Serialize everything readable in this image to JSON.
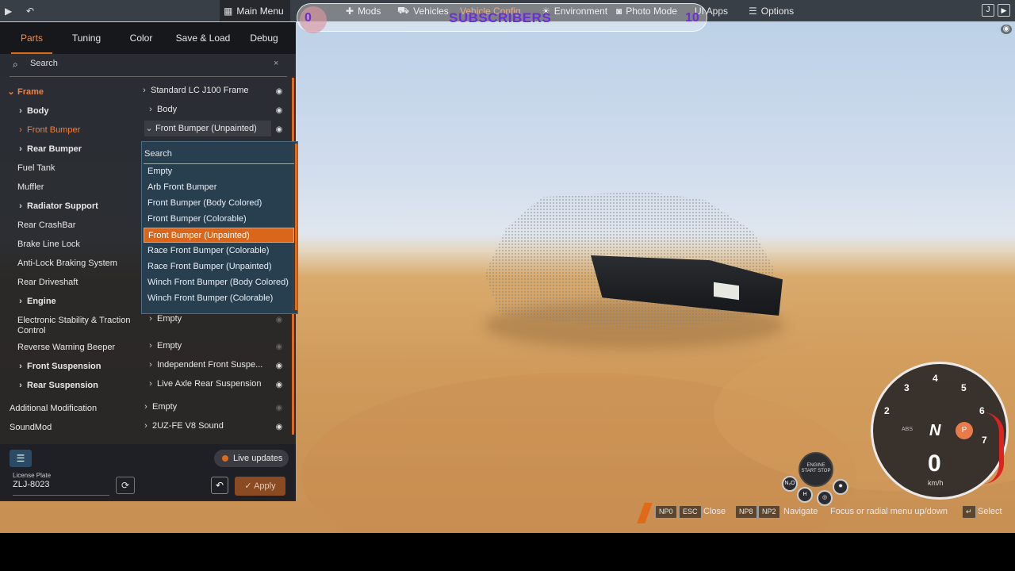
{
  "topbar": {
    "main_menu": "Main Menu",
    "mods": "Mods",
    "vehicles": "Vehicles",
    "vehicle_config": "Vehicle Config",
    "environment": "Environment",
    "photo_mode": "Photo Mode",
    "ui_apps": "UI Apps",
    "options": "Options"
  },
  "subscribers": {
    "title": "SUBSCRIBERS",
    "left_count": "0",
    "right_count": "10"
  },
  "tabs": [
    "Parts",
    "Tuning",
    "Color",
    "Save & Load",
    "Debug"
  ],
  "search": {
    "placeholder": "Search",
    "clear": "×"
  },
  "slots": [
    {
      "label": "Frame",
      "chev": "⌄",
      "part": "Standard LC J100 Frame",
      "part_chev": "›"
    },
    {
      "label": "Body",
      "chev": "›",
      "part": "Body",
      "part_chev": "›"
    },
    {
      "label": "Front Bumper",
      "chev": "›",
      "part": "Front Bumper (Unpainted)",
      "part_chev": "⌄"
    },
    {
      "label": "Rear Bumper",
      "chev": "›"
    },
    {
      "label": "Fuel Tank"
    },
    {
      "label": "Muffler"
    },
    {
      "label": "Radiator Support",
      "chev": "›"
    },
    {
      "label": "Rear CrashBar"
    },
    {
      "label": "Brake Line Lock"
    },
    {
      "label": "Anti-Lock Braking System"
    },
    {
      "label": "Rear Driveshaft"
    },
    {
      "label": "Engine",
      "chev": "›"
    },
    {
      "label": "Electronic Stability & Traction Control",
      "part": "Empty",
      "part_chev": "›"
    },
    {
      "label": "Reverse Warning Beeper",
      "part": "Empty",
      "part_chev": "›"
    },
    {
      "label": "Front Suspension",
      "chev": "›",
      "part": "Independent Front Suspe...",
      "part_chev": "›"
    },
    {
      "label": "Rear Suspension",
      "chev": "›",
      "part": "Live Axle Rear Suspension",
      "part_chev": "›"
    },
    {
      "label": "Additional Modification",
      "part": "Empty",
      "part_chev": "›"
    },
    {
      "label": "SoundMod",
      "part": "2UZ-FE V8 Sound",
      "part_chev": "›"
    }
  ],
  "dropdown": {
    "search": "Search",
    "options": [
      "Empty",
      "Arb Front Bumper",
      "Front Bumper (Body Colored)",
      "Front Bumper (Colorable)",
      "Front Bumper (Unpainted)",
      "Race Front Bumper (Colorable)",
      "Race Front Bumper (Unpainted)",
      "Winch Front Bumper (Body Colored)",
      "Winch Front Bumper (Colorable)"
    ],
    "selected": "Front Bumper (Unpainted)"
  },
  "bottom": {
    "live_updates": "Live updates",
    "plate_label": "License Plate",
    "plate_value": "ZLJ-8023",
    "apply": "Apply"
  },
  "dash": {
    "speed": "0",
    "unit": "km/h",
    "gear": "N",
    "park": "P",
    "abs": "ABS",
    "engine": "ENGINE START STOP",
    "ticks": [
      "2",
      "3",
      "4",
      "5",
      "6",
      "7"
    ]
  },
  "hints": {
    "np0": "NP0",
    "esc": "ESC",
    "close": "Close",
    "np8": "NP8",
    "np2": "NP2",
    "navigate": "Navigate",
    "focus": "Focus or radial menu up/down",
    "select": "Select"
  },
  "colors": {
    "accent": "#e06a1a",
    "dropdown_bg": "#28405a",
    "subscriber": "#6a2fd8"
  }
}
